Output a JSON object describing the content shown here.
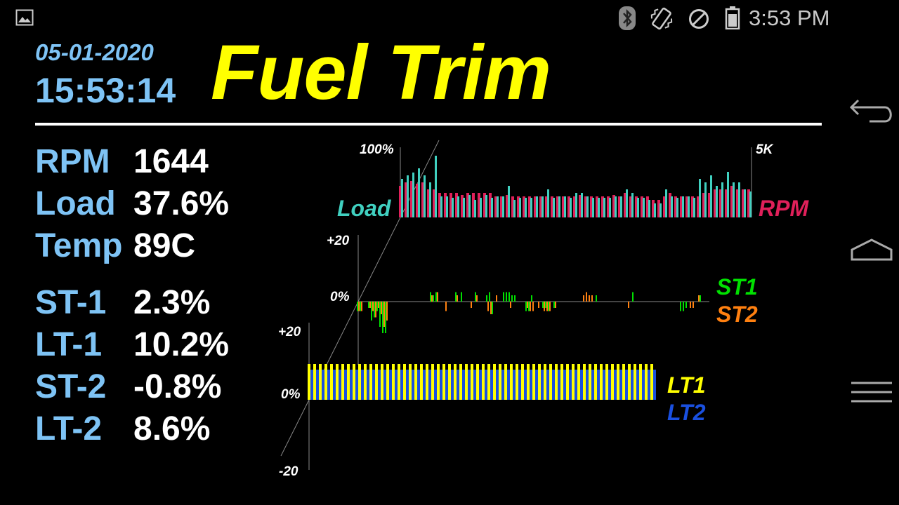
{
  "status_bar": {
    "time": "3:53 PM",
    "icons": [
      "image-icon",
      "bluetooth-icon",
      "vibrate-icon",
      "do-not-disturb-icon",
      "battery-icon"
    ]
  },
  "header": {
    "date": "05-01-2020",
    "time": "15:53:14",
    "title": "Fuel Trim"
  },
  "readings": [
    {
      "label": "RPM",
      "value": "1644"
    },
    {
      "label": "Load",
      "value": "37.6%"
    },
    {
      "label": "Temp",
      "value": "89C"
    },
    {
      "label": "ST-1",
      "value": "2.3%"
    },
    {
      "label": "LT-1",
      "value": "10.2%"
    },
    {
      "label": "ST-2",
      "value": "-0.8%"
    },
    {
      "label": "LT-2",
      "value": "8.6%"
    }
  ],
  "nav_bar": {
    "icons": [
      "back-icon",
      "home-icon",
      "menu-icon"
    ]
  },
  "colors": {
    "label": "#7ec3f5",
    "title": "#ffff00",
    "load": "#40d0c0",
    "rpm": "#e0205a",
    "st1": "#00e000",
    "st2": "#ff8010",
    "lt1": "#ffff00",
    "lt2": "#1a50e0"
  },
  "chart_data": [
    {
      "type": "bar",
      "name": "load-rpm",
      "ytick_left": "100%",
      "ytick_right": "5K",
      "series": [
        {
          "name": "Load",
          "axis": "left",
          "values": [
            55,
            60,
            64,
            70,
            60,
            50,
            88,
            30,
            30,
            28,
            30,
            28,
            32,
            25,
            28,
            32,
            28,
            30,
            30,
            45,
            25,
            28,
            28,
            28,
            30,
            30,
            40,
            28,
            30,
            30,
            28,
            35,
            35,
            30,
            28,
            28,
            28,
            28,
            30,
            30,
            40,
            35,
            28,
            28,
            25,
            20,
            20,
            40,
            30,
            28,
            30,
            30,
            28,
            55,
            50,
            60,
            45,
            50,
            65,
            50,
            50,
            40,
            37
          ]
        },
        {
          "name": "RPM",
          "axis": "right",
          "values": [
            45,
            50,
            52,
            48,
            50,
            40,
            40,
            35,
            35,
            35,
            35,
            32,
            35,
            35,
            35,
            35,
            35,
            30,
            30,
            32,
            30,
            30,
            30,
            30,
            30,
            30,
            30,
            30,
            30,
            30,
            30,
            30,
            32,
            30,
            30,
            30,
            30,
            30,
            32,
            30,
            35,
            30,
            30,
            30,
            30,
            25,
            25,
            30,
            35,
            30,
            30,
            30,
            30,
            30,
            35,
            35,
            40,
            40,
            40,
            45,
            40,
            40,
            40
          ]
        }
      ]
    },
    {
      "type": "bar",
      "name": "short-term-trim",
      "ytick_top": "+20",
      "ytick_zero": "0%",
      "ylim": [
        -20,
        20
      ],
      "series": [
        {
          "name": "ST1",
          "values": [
            -3,
            -3,
            0,
            0,
            -2,
            -6,
            -5,
            -3,
            -8,
            -10,
            -10,
            0,
            0,
            0,
            0,
            0,
            0,
            0,
            0,
            0,
            0,
            0,
            0,
            0,
            0,
            0,
            3,
            2,
            3,
            0,
            0,
            0,
            0,
            0,
            0,
            3,
            0,
            3,
            0,
            0,
            0,
            0,
            3,
            0,
            0,
            0,
            2,
            3,
            -4,
            0,
            0,
            0,
            3,
            3,
            3,
            2,
            2,
            0,
            0,
            0,
            -3,
            -3,
            2,
            0,
            0,
            0,
            -2,
            -2,
            -3,
            0,
            -2,
            0,
            0,
            0,
            0,
            0,
            0,
            0,
            0,
            0,
            0,
            0,
            0,
            0,
            0,
            2,
            0,
            0,
            0,
            0,
            0,
            0,
            0,
            0,
            0,
            0,
            0,
            0,
            3,
            0,
            0,
            0,
            0,
            0,
            0,
            0,
            0,
            0,
            0,
            0,
            0,
            0,
            0,
            0,
            0,
            -3,
            -3,
            -2,
            0,
            0,
            0,
            0,
            2
          ]
        },
        {
          "name": "ST2",
          "values": [
            -3,
            -3,
            0,
            0,
            -2,
            -3,
            -5,
            -2,
            -4,
            -8,
            -6,
            0,
            0,
            0,
            0,
            0,
            0,
            0,
            0,
            0,
            0,
            0,
            0,
            0,
            0,
            0,
            2,
            0,
            3,
            0,
            0,
            -3,
            0,
            0,
            0,
            2,
            0,
            0,
            0,
            0,
            -2,
            0,
            2,
            0,
            0,
            0,
            -3,
            -4,
            0,
            2,
            0,
            0,
            0,
            0,
            -2,
            0,
            0,
            0,
            0,
            0,
            -2,
            -3,
            -3,
            0,
            -2,
            0,
            -3,
            -3,
            -3,
            0,
            -2,
            0,
            0,
            0,
            0,
            0,
            0,
            0,
            0,
            0,
            2,
            3,
            2,
            2,
            0,
            0,
            0,
            0,
            0,
            0,
            0,
            0,
            0,
            0,
            0,
            0,
            -2,
            0,
            0,
            0,
            0,
            0,
            0,
            0,
            0,
            0,
            0,
            0,
            0,
            0,
            0,
            0,
            0,
            0,
            0,
            0,
            0,
            0,
            -2,
            -2,
            0,
            2
          ]
        }
      ]
    },
    {
      "type": "bar",
      "name": "long-term-trim",
      "ytick_top": "+20",
      "ytick_zero": "0%",
      "ytick_bottom": "-20",
      "ylim": [
        -20,
        20
      ],
      "series": [
        {
          "name": "LT1",
          "value": 10.2,
          "count": 62
        },
        {
          "name": "LT2",
          "value": 8.6,
          "count": 62
        }
      ]
    }
  ]
}
